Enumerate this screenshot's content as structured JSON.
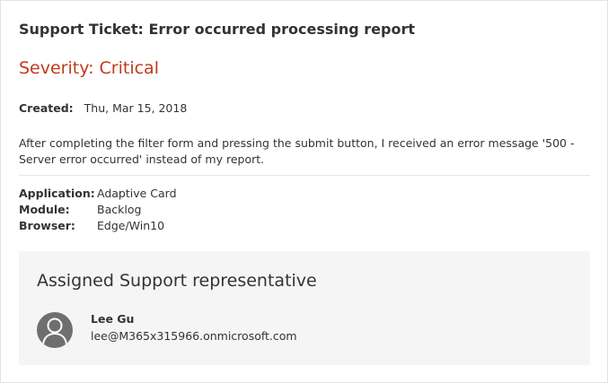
{
  "ticket": {
    "title": "Support Ticket: Error occurred processing report",
    "severity": "Severity: Critical",
    "created_label": "Created:",
    "created_value": "Thu, Mar 15, 2018",
    "description": "After completing the filter form and pressing the submit button, I received an error message '500 - Server error occurred' instead of my report."
  },
  "facts": [
    {
      "key": "Application:",
      "value": "Adaptive Card"
    },
    {
      "key": "Module:",
      "value": "Backlog"
    },
    {
      "key": "Browser:",
      "value": "Edge/Win10"
    }
  ],
  "assigned": {
    "title": "Assigned Support representative",
    "name": "Lee Gu",
    "email": "lee@M365x315966.onmicrosoft.com",
    "avatar_icon": "person-icon"
  },
  "colors": {
    "severity": "#c13a1b",
    "panel_bg": "#f5f5f5",
    "avatar_bg": "#6f6f6f"
  }
}
